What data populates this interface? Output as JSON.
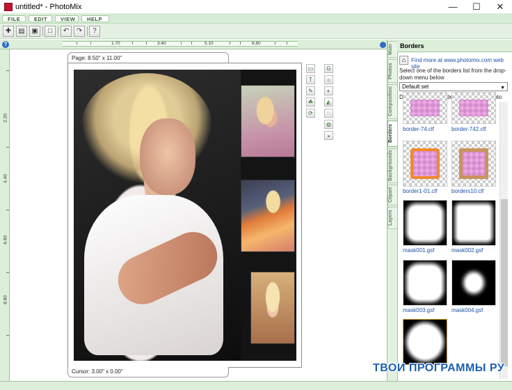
{
  "window": {
    "title": "untitled* - PhotoMix",
    "minimize": "—",
    "maximize": "☐",
    "close": "✕"
  },
  "menu": [
    "FILE",
    "EDIT",
    "VIEW",
    "HELP"
  ],
  "toolbar": {
    "icons": [
      "new-icon",
      "open-icon",
      "save-icon",
      "fit-icon",
      "undo-icon",
      "redo-icon",
      "help-icon"
    ]
  },
  "ruler": {
    "h_labels": [
      "1.70",
      "3.40",
      "5.10",
      "6.80"
    ],
    "v_labels": [
      "2.20",
      "4.40",
      "6.60",
      "8.80"
    ]
  },
  "page": {
    "size_label": "Page: 8.50\" x 11.00\"",
    "cursor_label": "Cursor: 3.00\" x 0.00\""
  },
  "side_tabs": [
    "Main",
    "Photos",
    "Composition",
    "Borders",
    "Backgrounds",
    "Clipart",
    "Layers"
  ],
  "panel": {
    "title": "Borders",
    "find_more": "Find more at www.photomix.com web site",
    "description": "Select one of the borders list from the drop-down menu below",
    "select_value": "Default set",
    "instruction": "Double click on border to apply it to photo",
    "items": [
      {
        "label": "border-74.clf"
      },
      {
        "label": "border-742.clf"
      },
      {
        "label": "border1-01.clf"
      },
      {
        "label": "borders10.clf"
      },
      {
        "label": "mask001.gsf"
      },
      {
        "label": "mask002.gsf"
      },
      {
        "label": "mask003.gsf"
      },
      {
        "label": "mask004.gsf"
      },
      {
        "label": ""
      }
    ]
  },
  "watermark": "ТВОИ ПРОГРАММЫ РУ"
}
